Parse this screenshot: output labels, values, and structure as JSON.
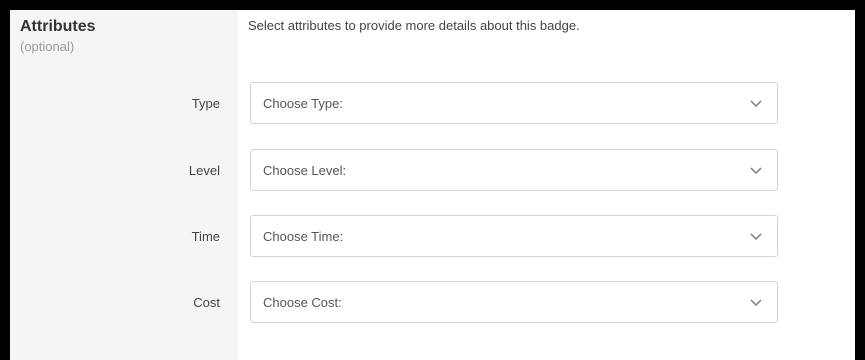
{
  "section": {
    "title": "Attributes",
    "subtitle": "(optional)",
    "instructions": "Select attributes to provide more details about this badge."
  },
  "fields": [
    {
      "label": "Type",
      "placeholder": "Choose Type:",
      "icon": "chevron-down-icon"
    },
    {
      "label": "Level",
      "placeholder": "Choose Level:",
      "icon": "chevron-down-icon"
    },
    {
      "label": "Time",
      "placeholder": "Choose Time:",
      "icon": "chevron-down-icon"
    },
    {
      "label": "Cost",
      "placeholder": "Choose Cost:",
      "icon": "chevron-down-icon"
    }
  ]
}
